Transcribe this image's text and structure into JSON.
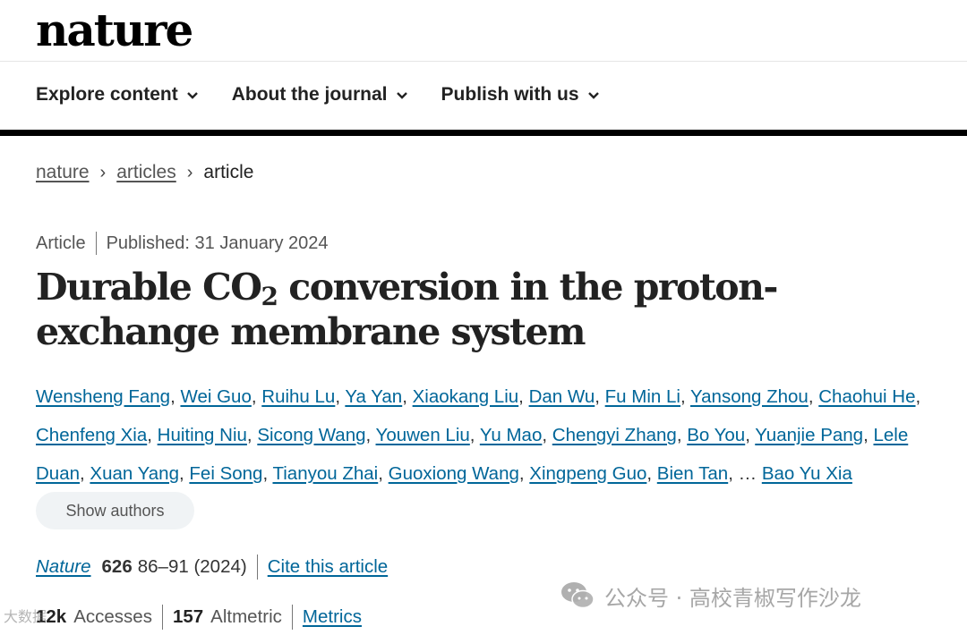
{
  "site": {
    "logo": "nature"
  },
  "nav": {
    "items": [
      {
        "label": "Explore content"
      },
      {
        "label": "About the journal"
      },
      {
        "label": "Publish with us"
      }
    ]
  },
  "breadcrumb": {
    "items": [
      "nature",
      "articles",
      "article"
    ]
  },
  "meta": {
    "type": "Article",
    "published": "Published: 31 January 2024"
  },
  "article": {
    "title_part1": "Durable CO",
    "title_sub": "2",
    "title_part2": " conversion in the proton-exchange membrane system"
  },
  "authors": {
    "names": [
      "Wensheng Fang",
      "Wei Guo",
      "Ruihu Lu",
      "Ya Yan",
      "Xiaokang Liu",
      "Dan Wu",
      "Fu Min Li",
      "Yansong Zhou",
      "Chaohui He",
      "Chenfeng Xia",
      "Huiting Niu",
      "Sicong Wang",
      "Youwen Liu",
      "Yu Mao",
      "Chengyi Zhang",
      "Bo You",
      "Yuanjie Pang",
      "Lele Duan",
      "Xuan Yang",
      "Fei Song",
      "Tianyou Zhai",
      "Guoxiong Wang",
      "Xingpeng Guo",
      "Bien Tan"
    ],
    "ellipsis": "…",
    "last": "Bao Yu Xia",
    "show_label": "Show authors"
  },
  "citation": {
    "journal": "Nature",
    "volume": "626",
    "pages_year": "86–91 (2024)",
    "cite_label": "Cite this article"
  },
  "stats": {
    "accesses_value": "12k",
    "accesses_label": "Accesses",
    "altmetric_value": "157",
    "altmetric_label": "Altmetric",
    "metrics_label": "Metrics"
  },
  "watermark": {
    "text": "公众号 · 高校青椒写作沙龙",
    "left_text": "大数据"
  },
  "colors": {
    "link": "#006699",
    "black_bar": "#000000",
    "pill_bg": "#f0f3f5"
  }
}
